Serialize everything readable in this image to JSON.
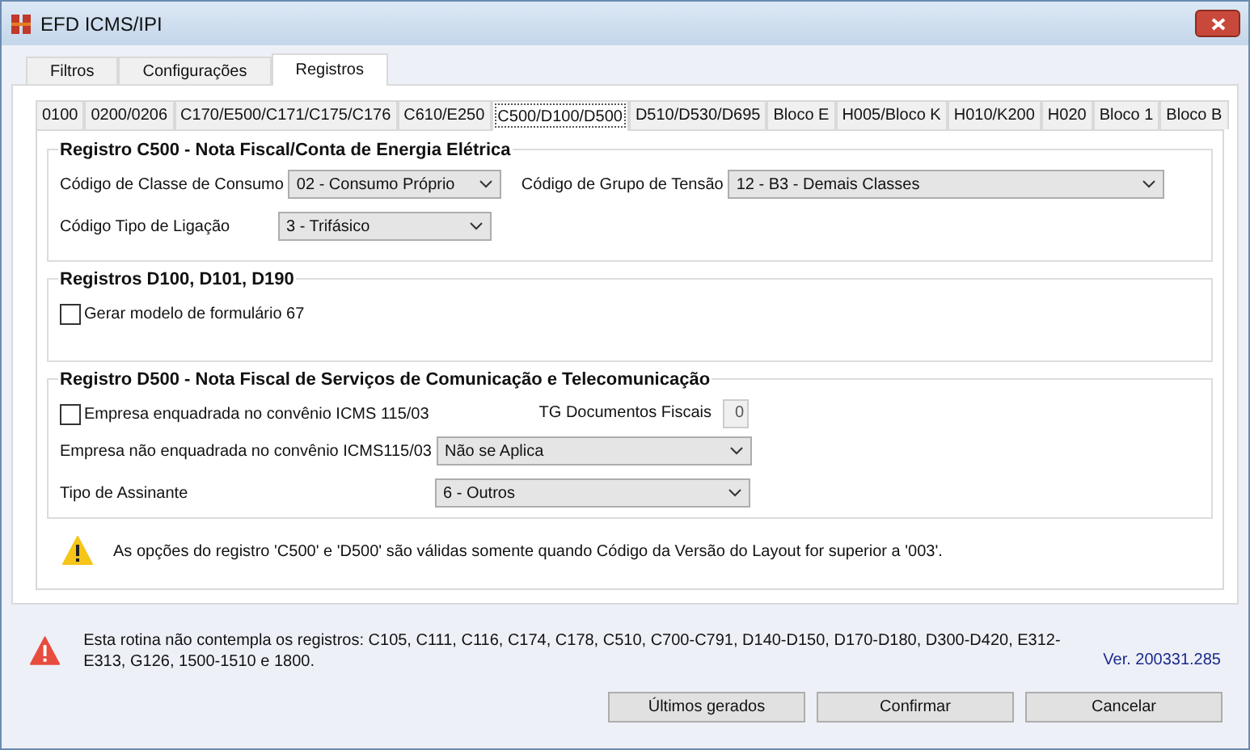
{
  "window": {
    "title": "EFD ICMS/IPI"
  },
  "tabs": [
    {
      "label": "Filtros",
      "selected": false
    },
    {
      "label": "Configurações",
      "selected": false
    },
    {
      "label": "Registros",
      "selected": true
    }
  ],
  "subtabs": [
    {
      "label": "0100",
      "selected": false
    },
    {
      "label": "0200/0206",
      "selected": false
    },
    {
      "label": "C170/E500/C171/C175/C176",
      "selected": false
    },
    {
      "label": "C610/E250",
      "selected": false
    },
    {
      "label": "C500/D100/D500",
      "selected": true
    },
    {
      "label": "D510/D530/D695",
      "selected": false
    },
    {
      "label": "Bloco E",
      "selected": false
    },
    {
      "label": "H005/Bloco K",
      "selected": false
    },
    {
      "label": "H010/K200",
      "selected": false
    },
    {
      "label": "H020",
      "selected": false
    },
    {
      "label": "Bloco 1",
      "selected": false
    },
    {
      "label": "Bloco B",
      "selected": false
    }
  ],
  "c500": {
    "title": "Registro C500 - Nota Fiscal/Conta de Energia Elétrica",
    "classe_consumo": {
      "label": "Código de Classe de Consumo",
      "value": "02 - Consumo Próprio"
    },
    "grupo_tensao": {
      "label": "Código de Grupo de Tensão",
      "value": "12 - B3 - Demais Classes"
    },
    "tipo_ligacao": {
      "label": "Código Tipo de Ligação",
      "value": "3 - Trifásico"
    }
  },
  "d100": {
    "title": "Registros D100, D101, D190",
    "gerar_modelo": {
      "label": "Gerar modelo de formulário 67",
      "checked": false
    }
  },
  "d500": {
    "title": "Registro D500 - Nota Fiscal de Serviços de Comunicação e Telecomunicação",
    "enquadrada": {
      "label": "Empresa enquadrada no convênio ICMS 115/03",
      "checked": false
    },
    "tg_documentos": {
      "label": "TG Documentos Fiscais",
      "value": "0"
    },
    "nao_enquadrada": {
      "label": "Empresa não enquadrada no convênio ICMS115/03",
      "value": "Não se Aplica"
    },
    "tipo_assinante": {
      "label": "Tipo de Assinante",
      "value": "6 - Outros"
    }
  },
  "layout_note": "As opções do registro 'C500' e 'D500' são válidas somente quando Código da Versão do Layout for superior a '003'.",
  "footer_note": "Esta rotina não contempla os registros: C105, C111, C116, C174, C178, C510, C700-C791, D140-D150, D170-D180, D300-D420, E312-E313, G126, 1500-1510 e 1800.",
  "version": "Ver. 200331.285",
  "buttons": [
    "Últimos gerados",
    "Confirmar",
    "Cancelar"
  ]
}
